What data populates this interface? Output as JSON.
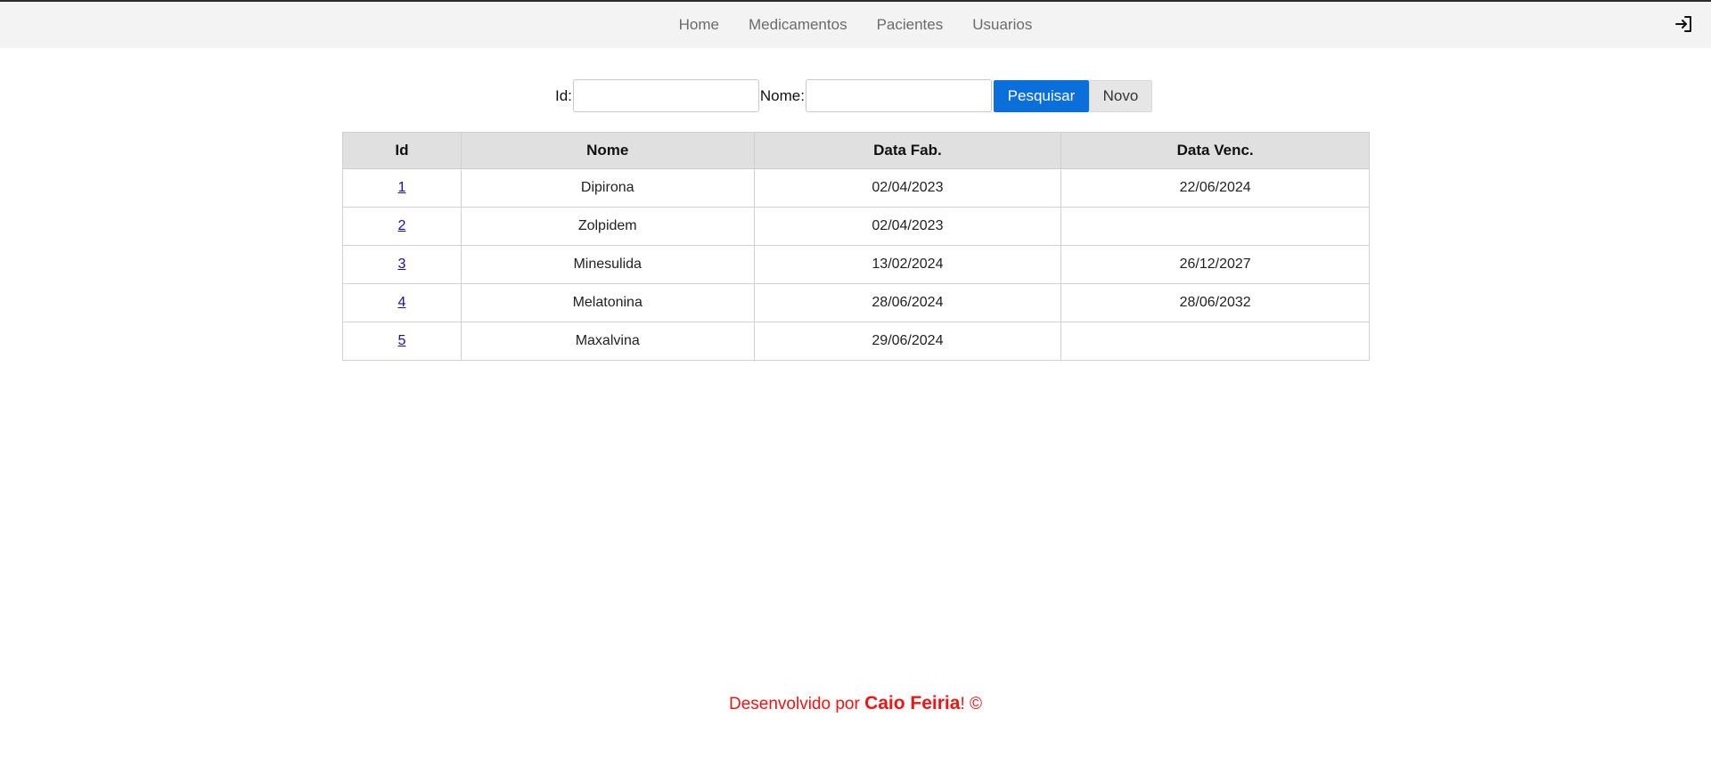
{
  "nav": {
    "items": [
      {
        "label": "Home"
      },
      {
        "label": "Medicamentos"
      },
      {
        "label": "Pacientes"
      },
      {
        "label": "Usuarios"
      }
    ],
    "logout_icon": "logout-icon"
  },
  "search": {
    "id_label": "Id:",
    "id_value": "",
    "nome_label": "Nome:",
    "nome_value": "",
    "search_button": "Pesquisar",
    "new_button": "Novo"
  },
  "table": {
    "headers": [
      "Id",
      "Nome",
      "Data Fab.",
      "Data Venc."
    ],
    "rows": [
      {
        "id": "1",
        "nome": "Dipirona",
        "fab": "02/04/2023",
        "venc": "22/06/2024"
      },
      {
        "id": "2",
        "nome": "Zolpidem",
        "fab": "02/04/2023",
        "venc": ""
      },
      {
        "id": "3",
        "nome": "Minesulida",
        "fab": "13/02/2024",
        "venc": "26/12/2027"
      },
      {
        "id": "4",
        "nome": "Melatonina",
        "fab": "28/06/2024",
        "venc": "28/06/2032"
      },
      {
        "id": "5",
        "nome": "Maxalvina",
        "fab": "29/06/2024",
        "venc": ""
      }
    ]
  },
  "footer": {
    "prefix": "Desenvolvido por ",
    "author": "Caio Feiria",
    "suffix": "! ©"
  },
  "colors": {
    "primary_button": "#0b6fdb",
    "footer_text": "#ef1515",
    "header_bg": "#f3f3f3"
  }
}
